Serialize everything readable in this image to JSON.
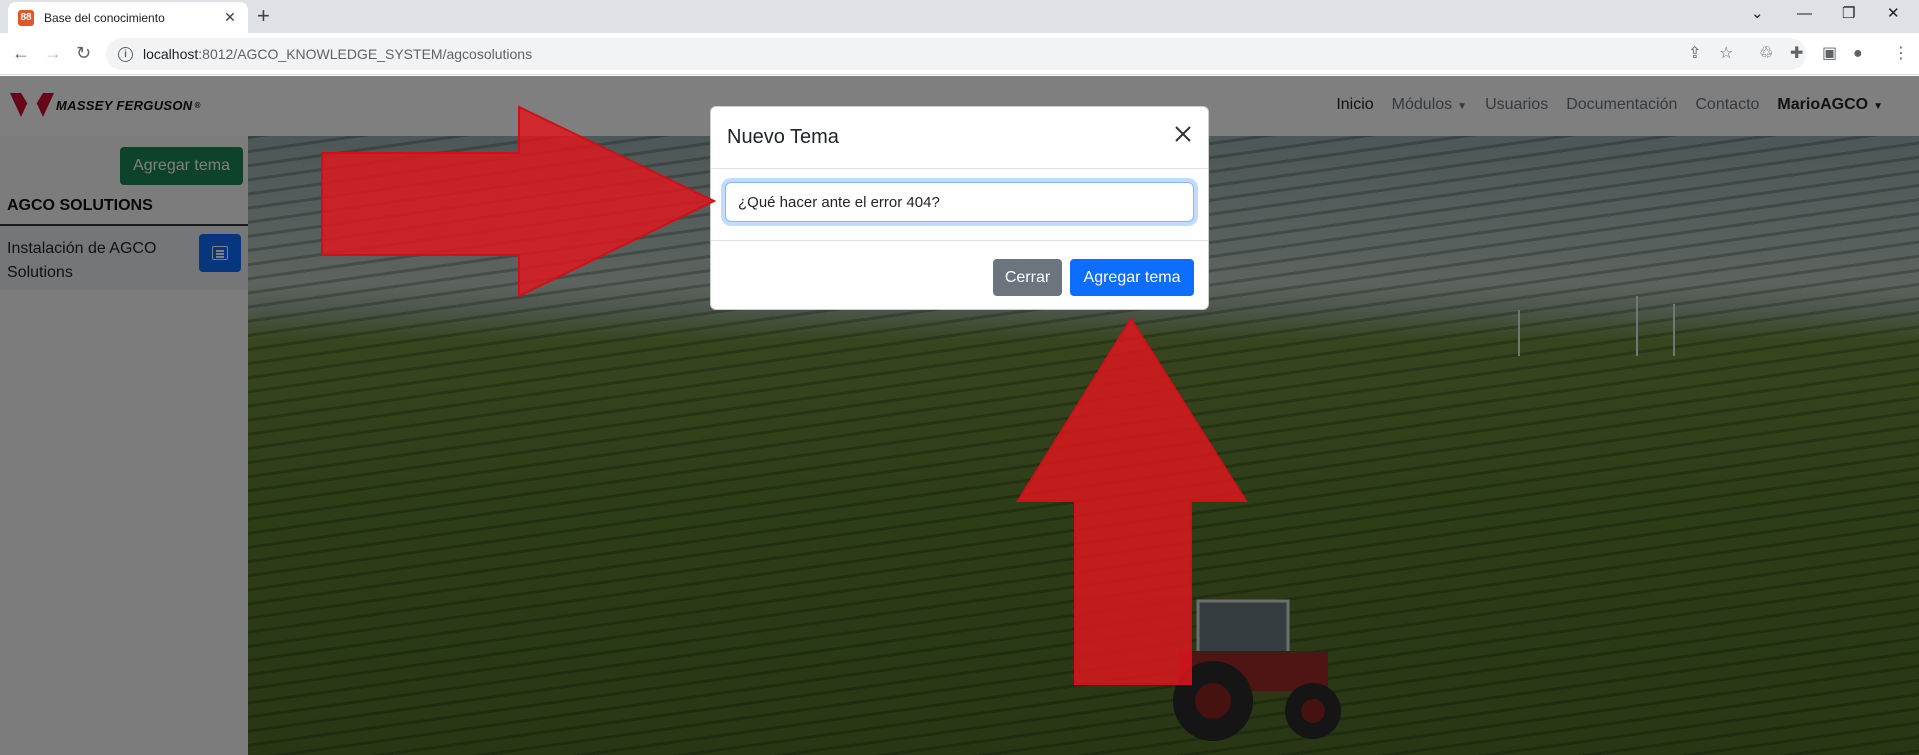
{
  "browser": {
    "tab_title": "Base del conocimiento",
    "tab_favicon_glyph": "88",
    "new_tab_glyph": "+",
    "url_host": "localhost",
    "url_path": ":8012/AGCO_KNOWLEDGE_SYSTEM/agcosolutions"
  },
  "navbar": {
    "brand": "MASSEY FERGUSON",
    "links": {
      "inicio": "Inicio",
      "modulos": "Módulos",
      "usuarios": "Usuarios",
      "documentacion": "Documentación",
      "contacto": "Contacto",
      "user": "MarioAGCO"
    }
  },
  "sidebar": {
    "add_button": "Agregar tema",
    "section_title": "AGCO SOLUTIONS",
    "items": [
      {
        "label": "Instalación de AGCO Solutions"
      }
    ]
  },
  "modal": {
    "title": "Nuevo Tema",
    "input_value": "¿Qué hacer ante el error 404?",
    "close_button": "Cerrar",
    "submit_button": "Agregar tema"
  },
  "colors": {
    "success": "#198754",
    "primary": "#0d6efd",
    "secondary": "#6c757d",
    "annotation_arrow": "#e3161e"
  },
  "icons": [
    "favicon-icon",
    "close-icon",
    "back-icon",
    "forward-icon",
    "reload-icon",
    "info-icon",
    "share-icon",
    "star-icon",
    "extensions-icon",
    "puzzle-icon",
    "sidepanel-icon",
    "profile-icon",
    "menu-icon",
    "list-icon",
    "massey-ferguson-logo"
  ]
}
